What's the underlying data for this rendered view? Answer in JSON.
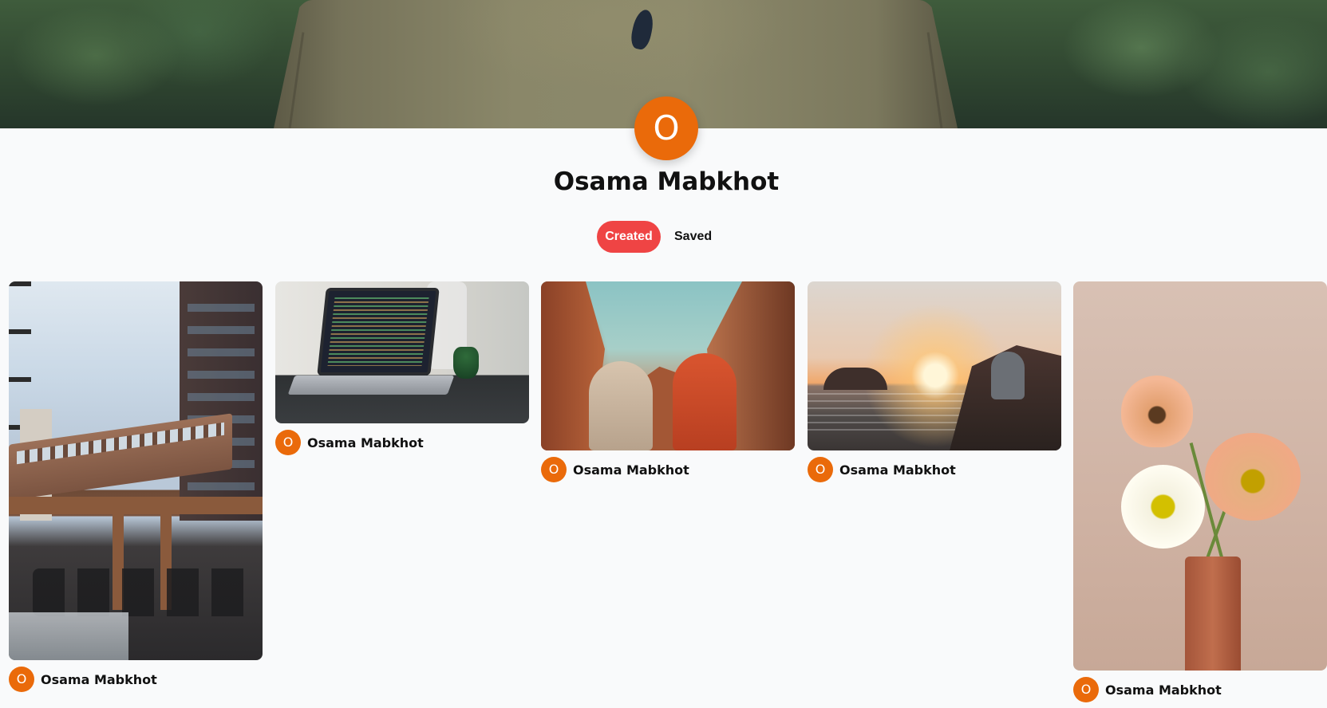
{
  "profile": {
    "avatar_initial": "O",
    "name": "Osama Mabkhot"
  },
  "tabs": [
    {
      "label": "Created",
      "active": true
    },
    {
      "label": "Saved",
      "active": false
    }
  ],
  "pins": [
    {
      "image": "elevated-train-city-photo",
      "author_initial": "O",
      "author": "Osama Mabkhot"
    },
    {
      "image": "laptop-code-photo",
      "author_initial": "O",
      "author": "Osama Mabkhot"
    },
    {
      "image": "canyon-two-people-photo",
      "author_initial": "O",
      "author": "Osama Mabkhot"
    },
    {
      "image": "sunset-sea-cliff-photo",
      "author_initial": "O",
      "author": "Osama Mabkhot"
    },
    {
      "image": "poppies-in-vase-photo",
      "author_initial": "O",
      "author": "Osama Mabkhot"
    }
  ],
  "colors": {
    "accent": "#ef4444",
    "avatar": "#ea6a0a",
    "background": "#f9fafb"
  }
}
